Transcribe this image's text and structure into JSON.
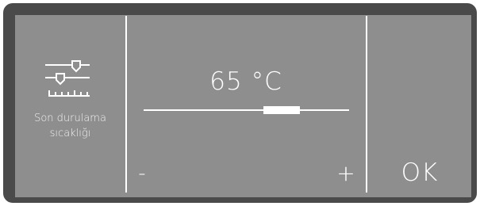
{
  "parameter": {
    "icon": "rinse-temperature-sliders-icon",
    "label_line1": "Son durulama",
    "label_line2": "sıcaklığı"
  },
  "setting": {
    "value_text": "65 °C",
    "slider_level": 0.67
  },
  "controls": {
    "decrease_label": "-",
    "increase_label": "+",
    "ok_label": "OK"
  },
  "colors": {
    "screen_background": "#8e8e8e",
    "frame": "#4a4a4a",
    "foreground": "#ffffff"
  }
}
